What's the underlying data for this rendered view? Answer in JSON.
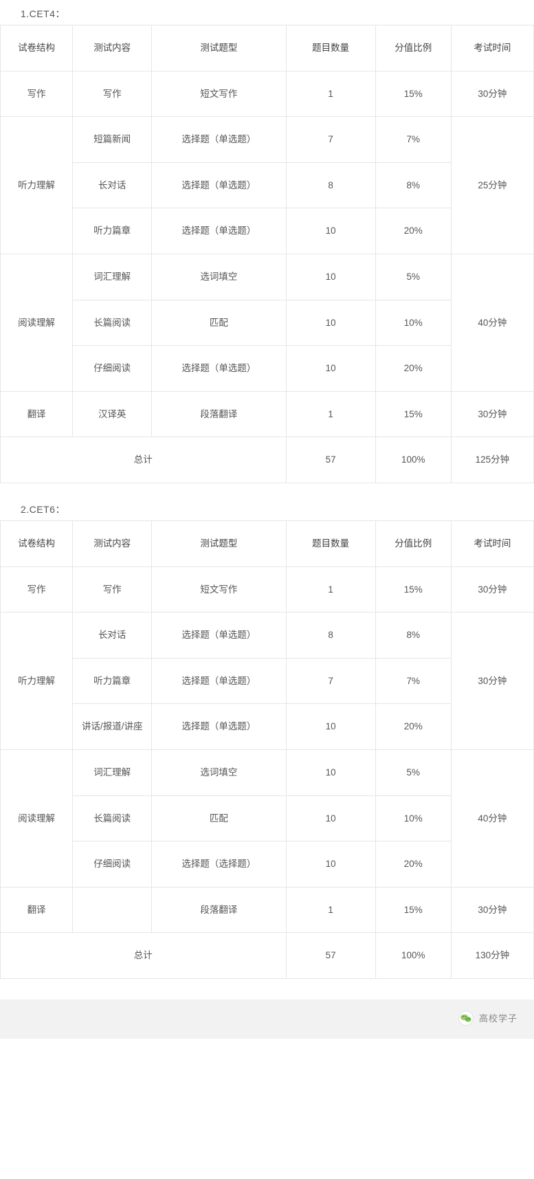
{
  "sections": [
    {
      "title": "1.CET4：",
      "headers": [
        "试卷结构",
        "测试内容",
        "测试题型",
        "题目数量",
        "分值比例",
        "考试时间"
      ],
      "rows": [
        {
          "structure": "写作",
          "content": "写作",
          "type": "短文写作",
          "count": "1",
          "pct": "15%",
          "time": "30分钟",
          "first": true,
          "span": 1,
          "tfirst": true,
          "tspan": 1
        },
        {
          "structure": "听力理解",
          "content": "短篇新闻",
          "type": "选择题（单选题）",
          "count": "7",
          "pct": "7%",
          "time": "25分钟",
          "first": true,
          "span": 3,
          "tfirst": true,
          "tspan": 3
        },
        {
          "content": "长对话",
          "type": "选择题（单选题）",
          "count": "8",
          "pct": "8%",
          "first": false,
          "tfirst": false
        },
        {
          "content": "听力篇章",
          "type": "选择题（单选题）",
          "count": "10",
          "pct": "20%",
          "first": false,
          "tfirst": false
        },
        {
          "structure": "阅读理解",
          "content": "词汇理解",
          "type": "选词填空",
          "count": "10",
          "pct": "5%",
          "time": "40分钟",
          "first": true,
          "span": 3,
          "tfirst": true,
          "tspan": 3
        },
        {
          "content": "长篇阅读",
          "type": "匹配",
          "count": "10",
          "pct": "10%",
          "first": false,
          "tfirst": false
        },
        {
          "content": "仔细阅读",
          "type": "选择题（单选题）",
          "count": "10",
          "pct": "20%",
          "first": false,
          "tfirst": false
        },
        {
          "structure": "翻译",
          "content": "汉译英",
          "type": "段落翻译",
          "count": "1",
          "pct": "15%",
          "time": "30分钟",
          "first": true,
          "span": 1,
          "tfirst": true,
          "tspan": 1
        }
      ],
      "total": {
        "label": "总计",
        "count": "57",
        "pct": "100%",
        "time": "125分钟"
      }
    },
    {
      "title": "2.CET6：",
      "headers": [
        "试卷结构",
        "测试内容",
        "测试题型",
        "题目数量",
        "分值比例",
        "考试时间"
      ],
      "rows": [
        {
          "structure": "写作",
          "content": "写作",
          "type": "短文写作",
          "count": "1",
          "pct": "15%",
          "time": "30分钟",
          "first": true,
          "span": 1,
          "tfirst": true,
          "tspan": 1
        },
        {
          "structure": "听力理解",
          "content": "长对话",
          "type": "选择题（单选题）",
          "count": "8",
          "pct": "8%",
          "time": "30分钟",
          "first": true,
          "span": 3,
          "tfirst": true,
          "tspan": 3
        },
        {
          "content": "听力篇章",
          "type": "选择题（单选题）",
          "count": "7",
          "pct": "7%",
          "first": false,
          "tfirst": false
        },
        {
          "content": "讲话/报道/讲座",
          "type": "选择题（单选题）",
          "count": "10",
          "pct": "20%",
          "first": false,
          "tfirst": false
        },
        {
          "structure": "阅读理解",
          "content": "词汇理解",
          "type": "选词填空",
          "count": "10",
          "pct": "5%",
          "time": "40分钟",
          "first": true,
          "span": 3,
          "tfirst": true,
          "tspan": 3
        },
        {
          "content": "长篇阅读",
          "type": "匹配",
          "count": "10",
          "pct": "10%",
          "first": false,
          "tfirst": false
        },
        {
          "content": "仔细阅读",
          "type": "选择题（选择题）",
          "count": "10",
          "pct": "20%",
          "first": false,
          "tfirst": false
        },
        {
          "structure": "翻译",
          "content": "",
          "type": "段落翻译",
          "count": "1",
          "pct": "15%",
          "time": "30分钟",
          "first": true,
          "span": 1,
          "tfirst": true,
          "tspan": 1
        }
      ],
      "total": {
        "label": "总计",
        "count": "57",
        "pct": "100%",
        "time": "130分钟"
      }
    }
  ],
  "footer": {
    "label": "高校学子"
  }
}
